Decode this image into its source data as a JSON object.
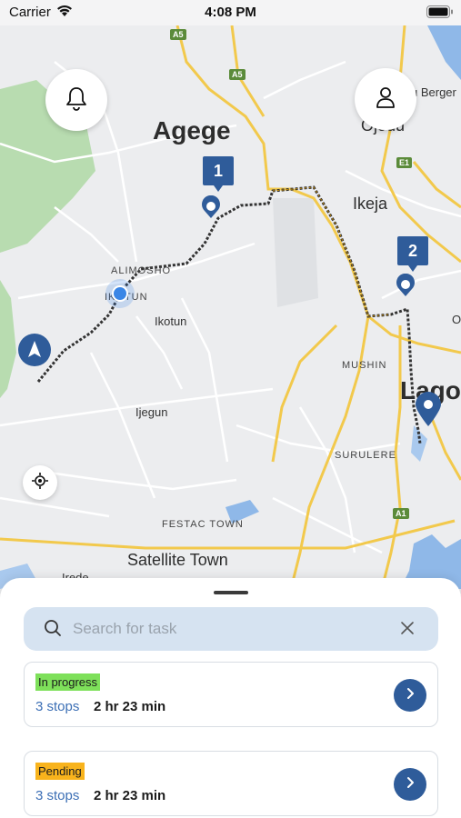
{
  "status_bar": {
    "carrier": "Carrier",
    "time": "4:08 PM"
  },
  "map": {
    "labels": {
      "agege": "Agege",
      "ikeja": "Ikeja",
      "ojodu": "Ojodu",
      "berger": "u Berger",
      "alimosho": "ALIMOSHO",
      "ikotun_area": "IKOTUN",
      "ikotun": "Ikotun",
      "mushin": "MUSHIN",
      "lagos": "Lagos",
      "ijegun": "Ijegun",
      "surulere": "SURULERE",
      "festac": "FESTAC TOWN",
      "satellite": "Satellite Town",
      "irede": "Irede",
      "o": "O"
    },
    "shields": {
      "a5_top": "A5",
      "a5_mid": "A5",
      "e1": "E1",
      "a1": "A1"
    },
    "markers": {
      "stop1": "1",
      "stop2": "2"
    },
    "colors": {
      "route": "#333333",
      "marker": "#2f5c9a",
      "current_location": "#3a86e6",
      "park": "#b8dcb0",
      "water": "#8fb8e8",
      "highway": "#f2c94c"
    }
  },
  "search": {
    "placeholder": "Search for task",
    "value": ""
  },
  "tasks": [
    {
      "status": "In progress",
      "stops": "3 stops",
      "duration": "2 hr 23 min",
      "status_color": "#7ee05a"
    },
    {
      "status": "Pending",
      "stops": "3 stops",
      "duration": "2 hr 23 min",
      "status_color": "#f8b31c"
    }
  ]
}
